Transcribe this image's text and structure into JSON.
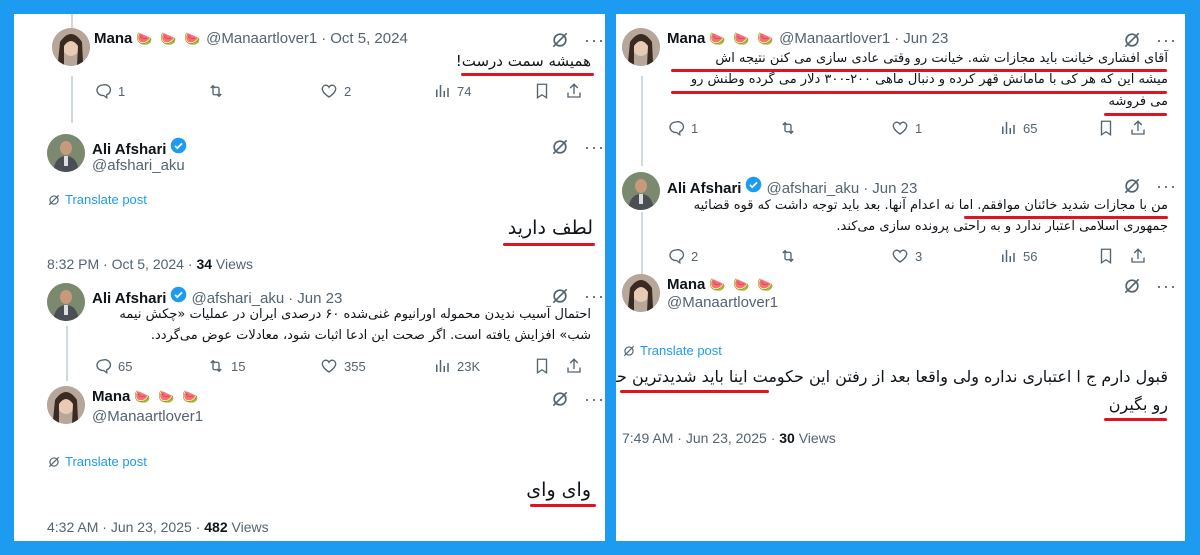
{
  "left": {
    "tweet1": {
      "name": "Mana",
      "emoji": "🍉 🍉 🍉",
      "handle": "@Manaartlover1",
      "sep": "·",
      "date": "Oct 5, 2024",
      "text": "همیشه سمت درست!",
      "replies": "1",
      "reposts": "",
      "likes": "2",
      "views": "74"
    },
    "tweet2": {
      "name": "Ali Afshari",
      "handle": "@afshari_aku",
      "translate": "Translate post",
      "text": "لطف دارید",
      "time": "8:32 PM",
      "sep": "·",
      "date": "Oct 5, 2024",
      "sep2": "·",
      "views_count": "34",
      "views_label": "Views"
    },
    "tweet3": {
      "name": "Ali Afshari",
      "handle": "@afshari_aku",
      "sep": "·",
      "date": "Jun 23",
      "text_line1": "احتمال آسیب ندیدن محموله اورانیوم غنی‌شده ۶۰ درصدی ایران در عملیات «چکش نیمه",
      "text_line2": "شب» افزایش یافته است. اگر صحت این ادعا اثبات شود، معادلات عوض می‌گردد.",
      "replies": "65",
      "reposts": "15",
      "likes": "355",
      "views": "23K"
    },
    "tweet4": {
      "name": "Mana",
      "emoji": "🍉 🍉 🍉",
      "handle": "@Manaartlover1",
      "translate": "Translate post",
      "text": "وای وای",
      "time": "4:32 AM",
      "sep": "·",
      "date": "Jun 23, 2025",
      "sep2": "·",
      "views_count": "482",
      "views_label": "Views"
    }
  },
  "right": {
    "tweet1": {
      "name": "Mana",
      "emoji": "🍉 🍉 🍉",
      "handle": "@Manaartlover1",
      "sep": "·",
      "date": "Jun 23",
      "text_line1": "آقای افشاری خیانت باید مجازات شه. خیانت رو وقتی عادی سازی می کنن نتیجه اش",
      "text_line2": "میشه این که هر کی با مامانش قهر کرده و دنبال ماهی ۲۰۰-۳۰۰ دلار می گرده وطنش رو",
      "text_line3": "می فروشه",
      "replies": "1",
      "reposts": "",
      "likes": "1",
      "views": "65"
    },
    "tweet2": {
      "name": "Ali Afshari",
      "handle": "@afshari_aku",
      "sep": "·",
      "date": "Jun 23",
      "text_line1": "من با مجازات شدید خائنان موافقم. اما نه اعدام آنها. بعد باید توجه داشت که قوه قضائیه",
      "text_line2": "جمهوری اسلامی اعتبار ندارد و به راحتی پرونده سازی می‌کند.",
      "replies": "2",
      "reposts": "",
      "likes": "3",
      "views": "56"
    },
    "tweet3": {
      "name": "Mana",
      "emoji": "🍉 🍉 🍉",
      "handle": "@Manaartlover1",
      "translate": "Translate post",
      "text_line1": "قبول دارم ج ا اعتباری نداره ولی واقعا بعد از رفتن این حکومت اینا باید شدیدترین حکم",
      "text_line2": "رو بگیرن",
      "time": "7:49 AM",
      "sep": "·",
      "date": "Jun 23, 2025",
      "sep2": "·",
      "views_count": "30",
      "views_label": "Views"
    }
  },
  "colors": {
    "frame": "#1d9bf0",
    "highlight": "#e0141e",
    "muted": "#536471",
    "verified": "#1d9bf0"
  },
  "icons": [
    "reply-icon",
    "repost-icon",
    "like-icon",
    "views-icon",
    "bookmark-icon",
    "share-icon",
    "grok-icon",
    "more-icon",
    "verified-icon",
    "translate-icon"
  ]
}
